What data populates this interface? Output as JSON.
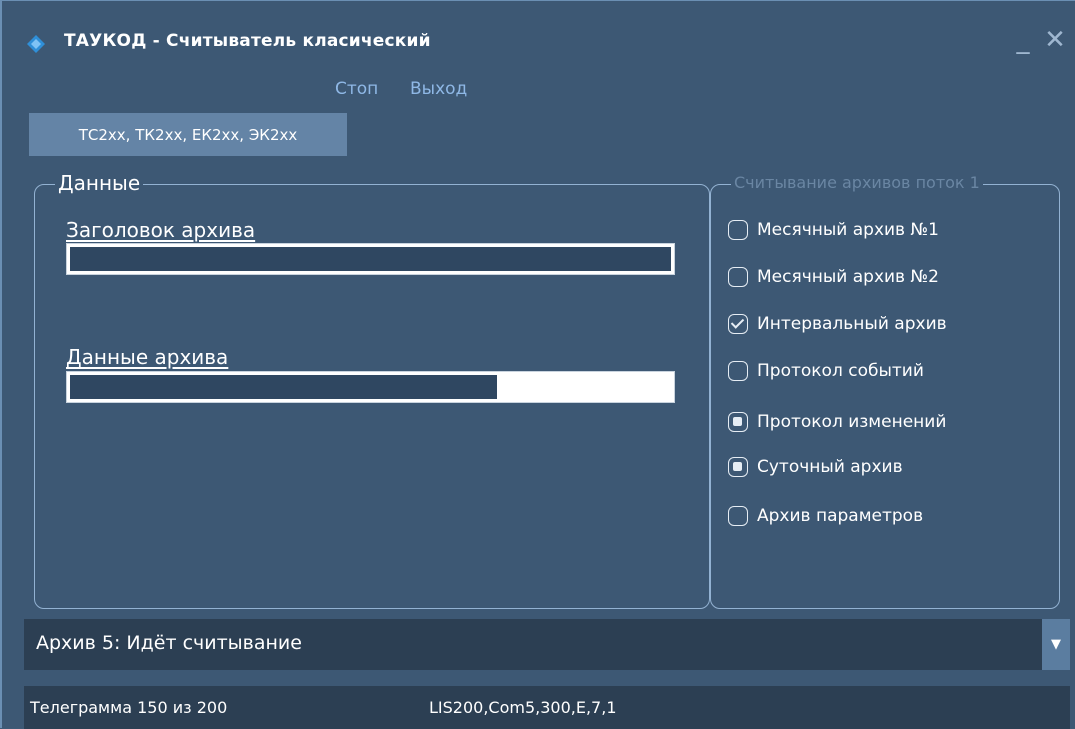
{
  "window": {
    "title": "ТАУКОД - Считыватель класический",
    "icon": "diamond-logo-icon",
    "minimize_label": "_",
    "close_label": "✕"
  },
  "menu": {
    "stop": "Стоп",
    "exit": "Выход"
  },
  "device_tab": {
    "label": "ТС2xx, ТК2xx, ЕК2xx, ЭК2xx"
  },
  "data_group": {
    "legend": "Данные",
    "header_progress": {
      "label": "Заголовок архива",
      "value": 1.0
    },
    "data_progress": {
      "label": "Данные архива",
      "value": 0.71
    }
  },
  "archives_group": {
    "legend": "Считывание архивов поток 1",
    "items": [
      {
        "label": "Месячный архив №1",
        "state": "unchecked"
      },
      {
        "label": "Месячный архив №2",
        "state": "unchecked"
      },
      {
        "label": "Интервальный архив",
        "state": "checked"
      },
      {
        "label": "Протокол событий",
        "state": "unchecked"
      },
      {
        "label": "Протокол изменений",
        "state": "partial"
      },
      {
        "label": "Суточный архив",
        "state": "partial"
      },
      {
        "label": "Архив параметров",
        "state": "unchecked"
      }
    ]
  },
  "status": {
    "text": "Архив 5: Идёт считывание",
    "dropdown_icon": "triangle-down-icon"
  },
  "footer": {
    "telegram": "Телеграмма 150 из 200",
    "port": "LIS200,Com5,300,E,7,1"
  },
  "colors": {
    "background": "#3d5874",
    "accent": "#8fb8e6",
    "progress_fill": "#2f4761",
    "status_bar": "#2c3f53"
  }
}
